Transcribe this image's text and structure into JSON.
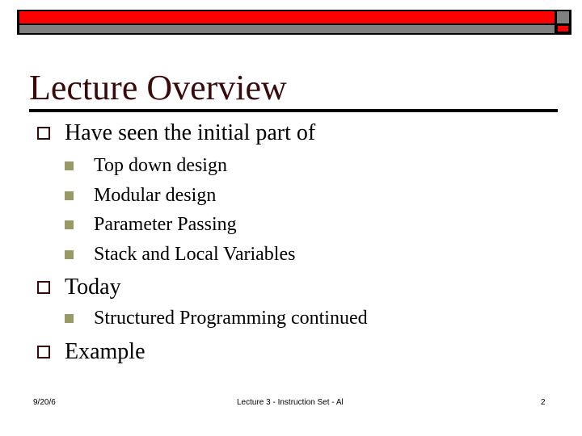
{
  "slide": {
    "title": "Lecture Overview",
    "bullets": [
      {
        "text": "Have seen the initial part of",
        "sub": [
          "Top down design",
          "Modular design",
          "Parameter Passing",
          "Stack and Local Variables"
        ]
      },
      {
        "text": "Today",
        "sub": [
          "Structured Programming continued"
        ]
      },
      {
        "text": "Example",
        "sub": []
      }
    ]
  },
  "footer": {
    "date": "9/20/6",
    "center": "Lecture 3 - Instruction Set - Al",
    "page": "2"
  },
  "colors": {
    "title": "#3a0a0a",
    "accent_red": "#ff0000",
    "accent_gray": "#808080",
    "sub_bullet": "#999966"
  }
}
